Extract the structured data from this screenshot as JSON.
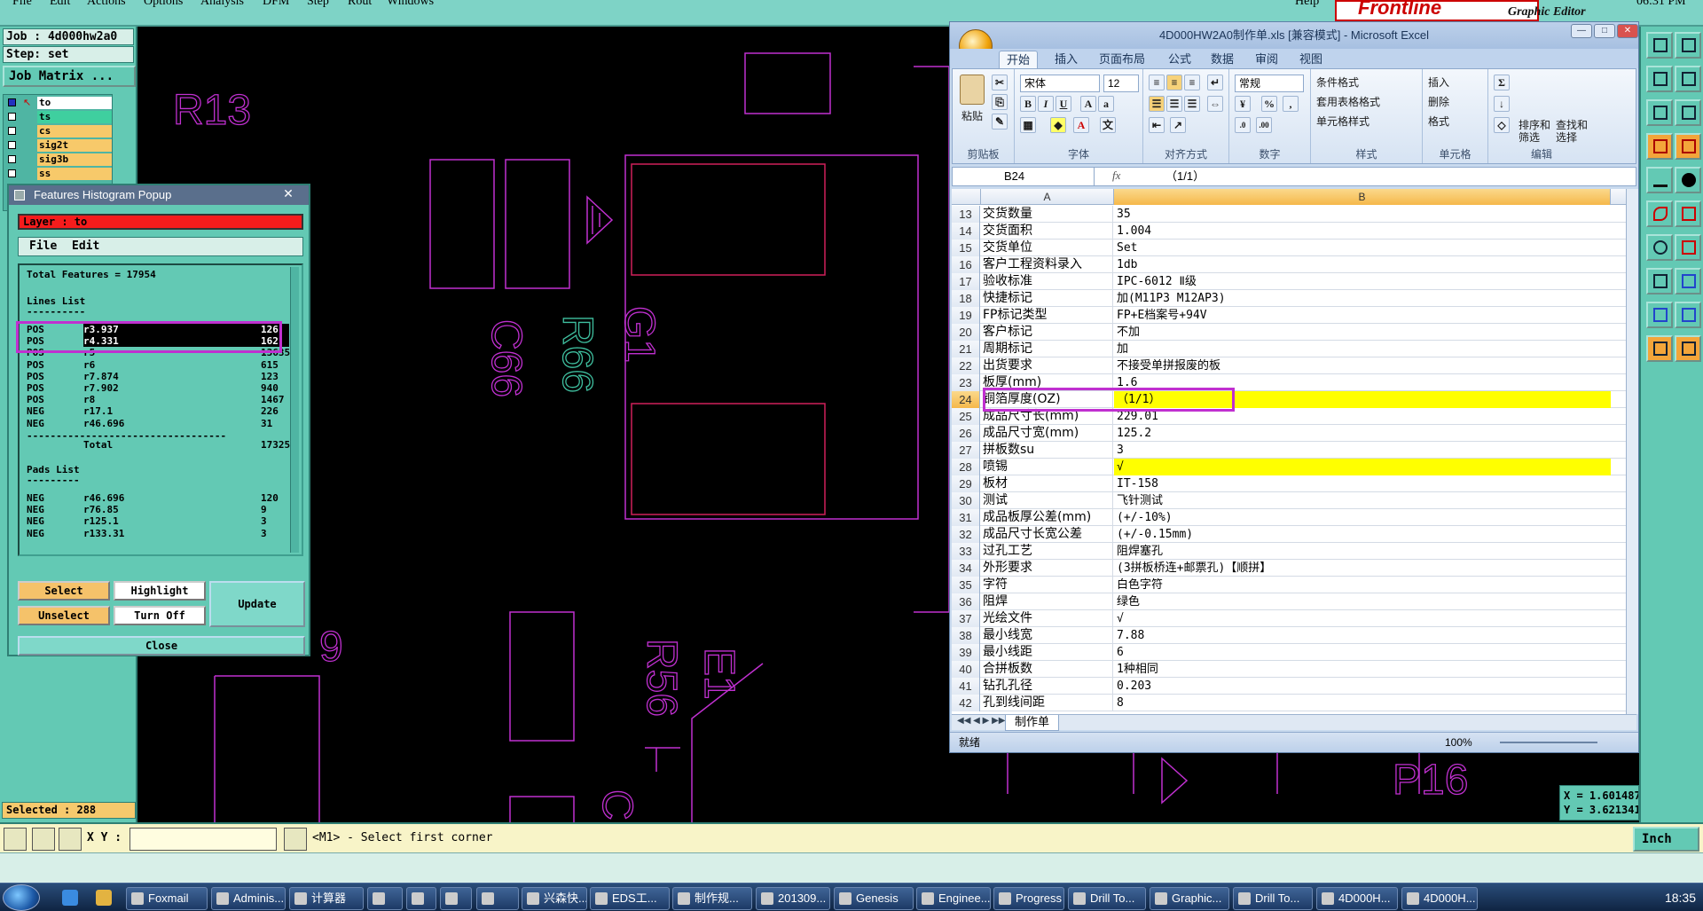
{
  "menu": {
    "items": [
      "File",
      "Edit",
      "Actions",
      "Options",
      "Analysis",
      "DFM",
      "Step",
      "Rout",
      "Windows"
    ],
    "help": "Help",
    "brand": "Frontline",
    "subtitle": "Graphic Editor",
    "clock": "06:31 PM"
  },
  "left": {
    "job": "Job : 4d000hw2a0",
    "step": "Step: set",
    "job_matrix": "Job Matrix ...",
    "layers": [
      "to",
      "ts",
      "cs",
      "sig2t",
      "sig3b",
      "ss"
    ],
    "selected": "Selected : 288"
  },
  "canvas": {
    "labels": [
      "R13",
      "C66",
      "R66",
      "G1",
      "R56",
      "E1",
      "P16",
      "C",
      "9"
    ]
  },
  "coords": {
    "x": "X = 1.601487\"",
    "y": "Y = 3.621341\""
  },
  "cmd": {
    "xy_label": "X Y :",
    "input_value": "",
    "message": "<M1> - Select first corner",
    "unit": "Inch"
  },
  "histogram": {
    "title": "Features Histogram Popup",
    "layer": "Layer :  to",
    "menu": [
      "File",
      "Edit"
    ],
    "total": "Total Features = 17954",
    "lines_header": "Lines List",
    "lines_rule": "----------",
    "lines": [
      {
        "pol": "POS",
        "sym": "r3.937",
        "count": "126"
      },
      {
        "pol": "POS",
        "sym": "r4.331",
        "count": "162"
      },
      {
        "pol": "POS",
        "sym": "r5",
        "count": "13635"
      },
      {
        "pol": "POS",
        "sym": "r6",
        "count": "615"
      },
      {
        "pol": "POS",
        "sym": "r7.874",
        "count": "123"
      },
      {
        "pol": "POS",
        "sym": "r7.902",
        "count": "940"
      },
      {
        "pol": "POS",
        "sym": "r8",
        "count": "1467"
      },
      {
        "pol": "NEG",
        "sym": "r17.1",
        "count": "226"
      },
      {
        "pol": "NEG",
        "sym": "r46.696",
        "count": "31"
      }
    ],
    "total_rule": "----------------------------------",
    "total_label": "Total",
    "total_value": "17325",
    "pads_header": "Pads List",
    "pads_rule": "---------",
    "pads": [
      {
        "pol": "NEG",
        "sym": "r46.696",
        "count": "120"
      },
      {
        "pol": "NEG",
        "sym": "r76.85",
        "count": "9"
      },
      {
        "pol": "NEG",
        "sym": "r125.1",
        "count": "3"
      },
      {
        "pol": "NEG",
        "sym": "r133.31",
        "count": "3"
      }
    ],
    "buttons": {
      "select": "Select",
      "highlight": "Highlight",
      "update": "Update",
      "unselect": "Unselect",
      "turnoff": "Turn Off",
      "close": "Close"
    }
  },
  "excel": {
    "title": "4D000HW2A0制作单.xls  [兼容模式] - Microsoft Excel",
    "tabs": [
      "开始",
      "插入",
      "页面布局",
      "公式",
      "数据",
      "审阅",
      "视图"
    ],
    "ribbon": {
      "paste": "粘贴",
      "clipboard": "剪贴板",
      "font_name": "宋体",
      "font_size": "12",
      "font": "字体",
      "align": "对齐方式",
      "number_format": "常规",
      "number": "数字",
      "styles": [
        "条件格式",
        "套用表格格式",
        "单元格样式"
      ],
      "style": "样式",
      "cells_ops": [
        "插入",
        "删除",
        "格式"
      ],
      "cells": "单元格",
      "sort": "排序和\n筛选",
      "find": "查找和\n选择",
      "edit": "编辑"
    },
    "name_box": "B24",
    "formula": "（1/1）",
    "col_a": "A",
    "col_b": "B",
    "rows": [
      {
        "n": "13",
        "a": "交货数量",
        "b": "35"
      },
      {
        "n": "14",
        "a": "交货面积",
        "b": "1.004"
      },
      {
        "n": "15",
        "a": "交货单位",
        "b": "Set"
      },
      {
        "n": "16",
        "a": "客户工程资料录入",
        "b": "1db"
      },
      {
        "n": "17",
        "a": "验收标准",
        "b": "IPC-6012 Ⅱ级"
      },
      {
        "n": "18",
        "a": "快捷标记",
        "b": "加(M11P3 M12AP3)"
      },
      {
        "n": "19",
        "a": "FP标记类型",
        "b": "FP+E档案号+94V"
      },
      {
        "n": "20",
        "a": "客户标记",
        "b": "不加"
      },
      {
        "n": "21",
        "a": "周期标记",
        "b": "加"
      },
      {
        "n": "22",
        "a": "出货要求",
        "b": "不接受单拼报废的板"
      },
      {
        "n": "23",
        "a": "板厚(mm)",
        "b": "1.6"
      },
      {
        "n": "24",
        "a": "铜箔厚度(OZ)",
        "b": "（1/1）",
        "hl": true
      },
      {
        "n": "25",
        "a": "成品尺寸长(mm)",
        "b": "229.01"
      },
      {
        "n": "26",
        "a": "成品尺寸宽(mm)",
        "b": "125.2"
      },
      {
        "n": "27",
        "a": "拼板数su",
        "b": "3"
      },
      {
        "n": "28",
        "a": "喷锡",
        "b": "√",
        "hl": true
      },
      {
        "n": "29",
        "a": "板材",
        "b": "IT-158"
      },
      {
        "n": "30",
        "a": "测试",
        "b": "飞针测试"
      },
      {
        "n": "31",
        "a": "成品板厚公差(mm)",
        "b": "(+/-10%)"
      },
      {
        "n": "32",
        "a": "成品尺寸长宽公差",
        "b": "(+/-0.15mm)"
      },
      {
        "n": "33",
        "a": "过孔工艺",
        "b": "阻焊塞孔"
      },
      {
        "n": "34",
        "a": "外形要求",
        "b": "(3拼板桥连+邮票孔)【顺拼】"
      },
      {
        "n": "35",
        "a": "字符",
        "b": "白色字符"
      },
      {
        "n": "36",
        "a": "阻焊",
        "b": "绿色"
      },
      {
        "n": "37",
        "a": "光绘文件",
        "b": "√"
      },
      {
        "n": "38",
        "a": "最小线宽",
        "b": "7.88"
      },
      {
        "n": "39",
        "a": "最小线距",
        "b": "6"
      },
      {
        "n": "40",
        "a": "合拼板数",
        "b": "1种相同"
      },
      {
        "n": "41",
        "a": "钻孔孔径",
        "b": "0.203"
      },
      {
        "n": "42",
        "a": "孔到线间距",
        "b": "8"
      }
    ],
    "sheet": "制作单",
    "status": "就绪",
    "zoom": "100%"
  },
  "taskbar": {
    "tasks": [
      "Foxmail",
      "Adminis...",
      "计算器",
      "",
      "",
      "",
      "",
      "兴森快...",
      "EDS工...",
      "制作规...",
      "201309...",
      "Genesis",
      "Enginee...",
      "Progress",
      "Drill To...",
      "Graphic...",
      "Drill To...",
      "4D000H...",
      "4D000H..."
    ],
    "time": "18:35"
  },
  "colors": {
    "teal": "#63c9b4",
    "magenta": "#c030d0",
    "pcb_red": "#d0205a",
    "yellow": "#ffff00"
  }
}
